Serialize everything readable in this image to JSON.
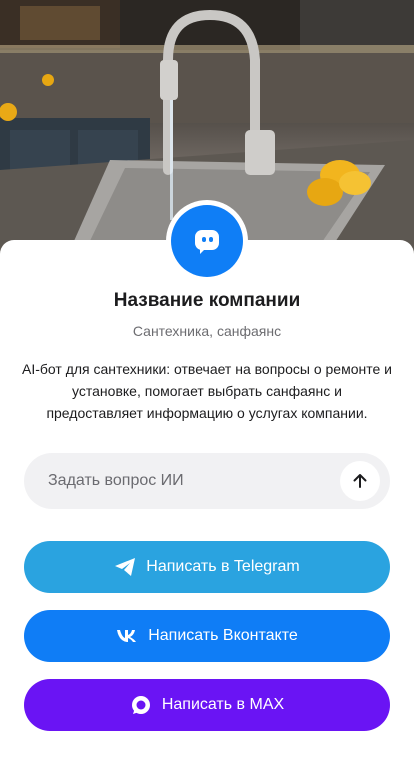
{
  "hero": {
    "image": "kitchen-sink-photo"
  },
  "company": {
    "name": "Название компании",
    "category": "Сантехника, санфаянс",
    "description": "AI-бот для сантехники: отвечает на вопросы о ремонте и установке, помогает выбрать санфаянс и предоставляет информацию о услугах компании."
  },
  "ask": {
    "placeholder": "Задать вопрос ИИ",
    "value": "",
    "send_icon": "arrow-up-icon"
  },
  "buttons": {
    "telegram": {
      "label": "Написать в Telegram",
      "icon": "telegram-icon",
      "color": "#2aa3e0"
    },
    "vk": {
      "label": "Написать Вконтакте",
      "icon": "vk-icon",
      "color": "#0f7df6"
    },
    "max": {
      "label": "Написать в MAX",
      "icon": "max-icon",
      "color": "#6a14f4"
    }
  },
  "colors": {
    "accent": "#0f7ef6"
  }
}
